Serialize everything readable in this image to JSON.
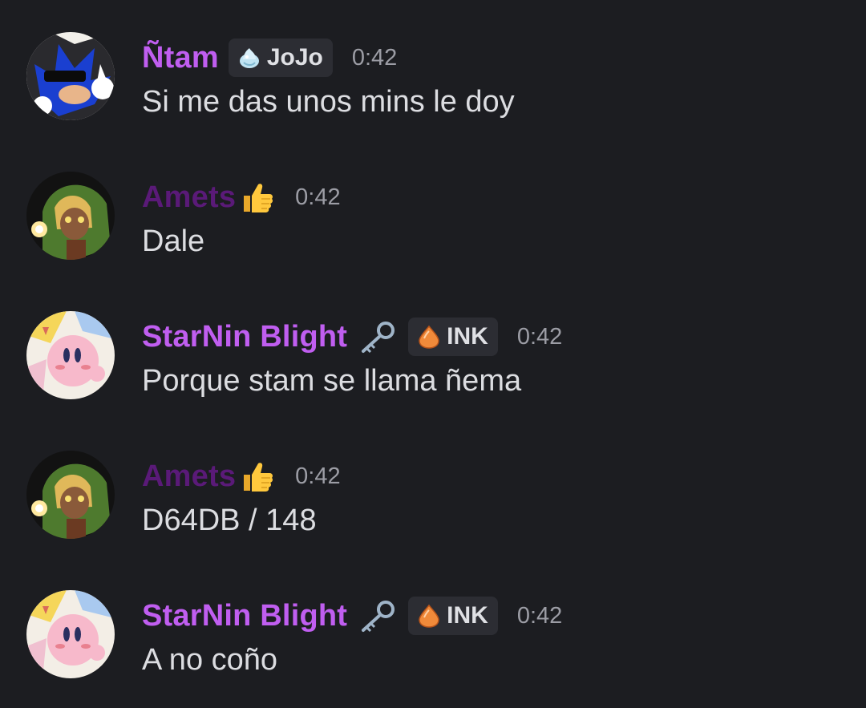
{
  "colors": {
    "background": "#1c1d21",
    "username_bright": "#c05ef0",
    "username_dark": "#5a1a78",
    "tag_background": "#2c2d33",
    "timestamp": "#9c9da5",
    "message_text": "#dcdde1"
  },
  "messages": [
    {
      "username": "Ñtam",
      "name_color": "#c05ef0",
      "tag": {
        "icon": "water-drop-icon",
        "label": "JoJo"
      },
      "time": "0:42",
      "text": "Si me das unos mins le doy",
      "avatar": "sonic-avatar"
    },
    {
      "username": "Amets",
      "name_color": "#5a1a78",
      "emoji": "thumbs-up-icon",
      "time": "0:42",
      "text": "Dale",
      "avatar": "link-avatar"
    },
    {
      "username": "StarNin Blight",
      "name_color": "#c05ef0",
      "role_icon": "key-icon",
      "tag": {
        "icon": "orange-gem-icon",
        "label": "INK"
      },
      "time": "0:42",
      "text": "Porque stam se llama ñema",
      "avatar": "kirby-avatar"
    },
    {
      "username": "Amets",
      "name_color": "#5a1a78",
      "emoji": "thumbs-up-icon",
      "time": "0:42",
      "text": "D64DB / 148",
      "avatar": "link-avatar"
    },
    {
      "username": "StarNin Blight",
      "name_color": "#c05ef0",
      "role_icon": "key-icon",
      "tag": {
        "icon": "orange-gem-icon",
        "label": "INK"
      },
      "time": "0:42",
      "text": "A no coño",
      "avatar": "kirby-avatar"
    }
  ]
}
